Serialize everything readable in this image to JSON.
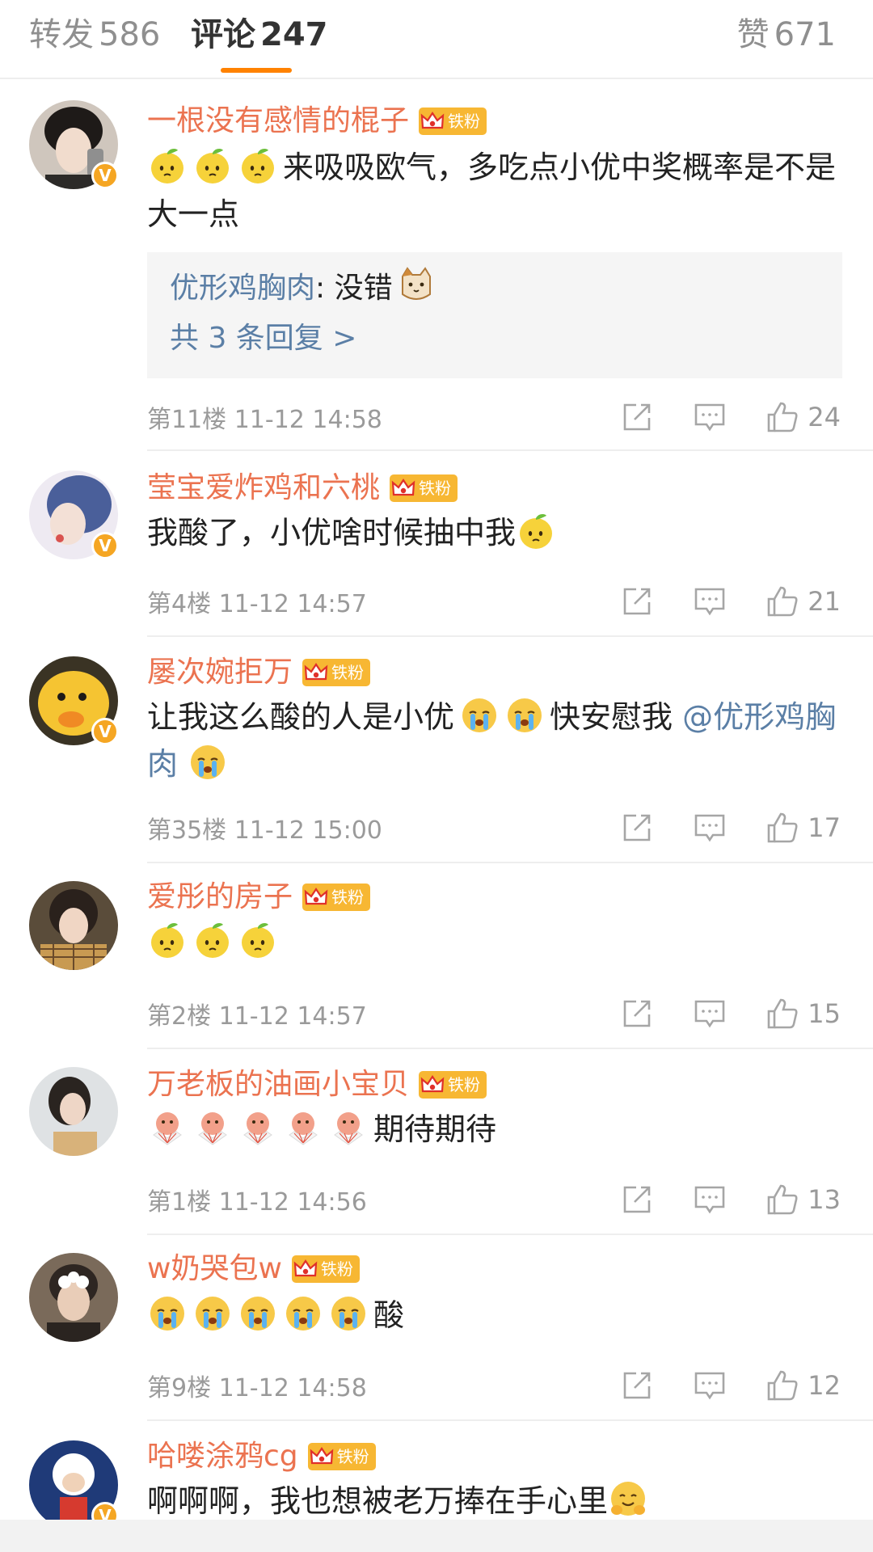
{
  "tabs": {
    "repost": {
      "label": "转发",
      "count": "586"
    },
    "comment": {
      "label": "评论",
      "count": "247"
    },
    "like": {
      "label": "赞",
      "count": "671"
    }
  },
  "colors": {
    "accent": "#ff8200",
    "username": "#eb7350",
    "link": "#5b7fa6",
    "fan_badge": "#f7b733"
  },
  "fan_badge_label": "铁粉",
  "comments": [
    {
      "user": "一根没有感情的棍子",
      "verified": true,
      "emojis": [
        "lemon-emoji",
        "lemon-emoji",
        "lemon-emoji"
      ],
      "text": "来吸吸欧气，多吃点小优中奖概率是不是大一点",
      "reply": {
        "user": "优形鸡胸肉",
        "sep": ": ",
        "text": "没错",
        "emoji": "cat-emoji",
        "more": "共 3 条回复 >"
      },
      "floor": "第11楼 11-12 14:58",
      "likes": "24"
    },
    {
      "user": "莹宝爱炸鸡和六桃",
      "verified": true,
      "text": "我酸了，小优啥时候抽中我",
      "trail_emoji": "lemon-emoji",
      "floor": "第4楼 11-12 14:57",
      "likes": "21"
    },
    {
      "user": "屡次婉拒万",
      "verified": true,
      "text": "让我这么酸的人是小优",
      "mid_text": "快安慰我",
      "mention": "@优形鸡胸肉",
      "floor": "第35楼 11-12 15:00",
      "likes": "17"
    },
    {
      "user": "爱彤的房子",
      "verified": false,
      "emojis": [
        "lemon-emoji",
        "lemon-emoji",
        "lemon-emoji"
      ],
      "floor": "第2楼 11-12 14:57",
      "likes": "15"
    },
    {
      "user": "万老板的油画小宝贝",
      "verified": false,
      "emojis": [
        "cheer-emoji",
        "cheer-emoji",
        "cheer-emoji",
        "cheer-emoji",
        "cheer-emoji"
      ],
      "text": "期待期待",
      "floor": "第1楼 11-12 14:56",
      "likes": "13"
    },
    {
      "user": "w奶哭包w",
      "verified": false,
      "emojis": [
        "cry-emoji",
        "cry-emoji",
        "cry-emoji",
        "cry-emoji",
        "cry-emoji"
      ],
      "text": "酸",
      "floor": "第9楼 11-12 14:58",
      "likes": "12"
    },
    {
      "user": "哈喽涂鸦cg",
      "verified": true,
      "text": "啊啊啊，我也想被老万捧在手心里",
      "trail_emoji": "hug-emoji"
    }
  ]
}
